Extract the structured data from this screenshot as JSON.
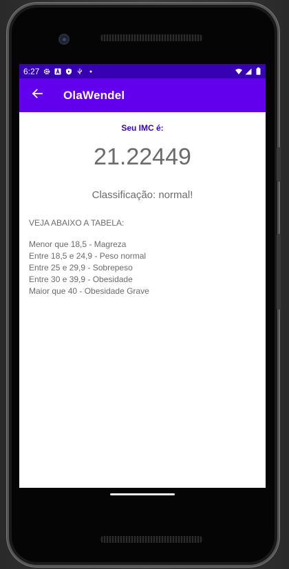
{
  "status_bar": {
    "time": "6:27",
    "left_icons": [
      "settings-icon",
      "a-badge-icon",
      "shield-play-icon",
      "usb-icon",
      "dot-icon"
    ],
    "right_icons": [
      "wifi-icon",
      "signal-icon",
      "battery-icon"
    ]
  },
  "app_bar": {
    "title": "OlaWendel",
    "back_icon": "arrow-left-icon"
  },
  "result": {
    "label": "Seu IMC é:",
    "value": "21.22449",
    "classification": "Classificação: normal!"
  },
  "table": {
    "title": "VEJA ABAIXO A TABELA:",
    "rows": [
      "Menor que 18,5 - Magreza",
      "Entre 18,5 e 24,9 - Peso normal",
      "Entre 25 e 29,9 - Sobrepeso",
      "Entre 30 e 39,9 - Obesidade",
      "Maior que 40 - Obesidade Grave"
    ]
  },
  "colors": {
    "status_bar": "#3700b3",
    "app_bar": "#6200ee",
    "accent_text": "#3700b3",
    "body_text": "#6b6b6b"
  }
}
